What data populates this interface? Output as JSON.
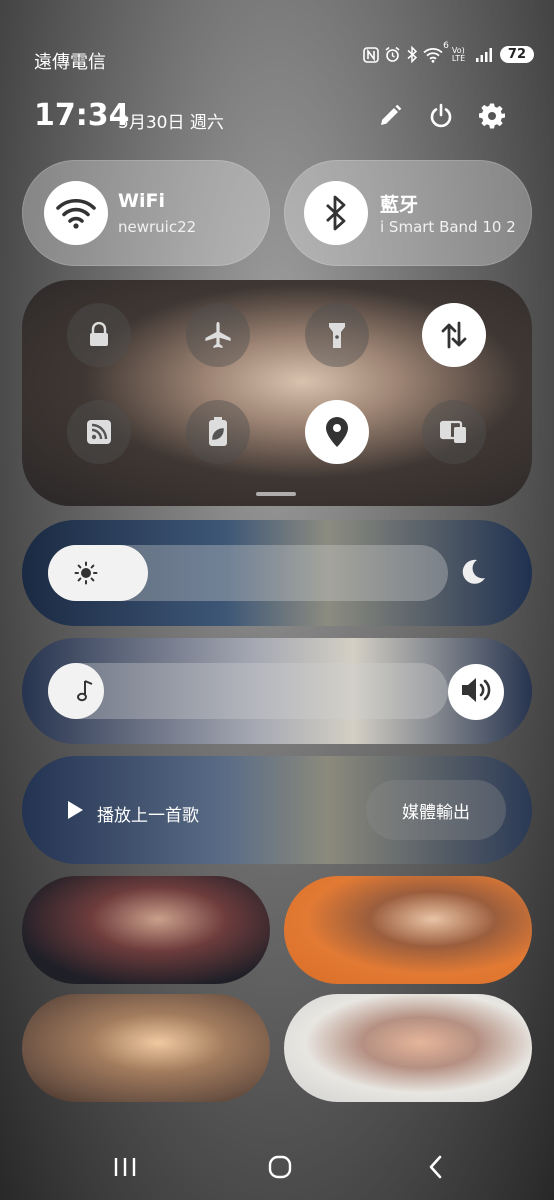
{
  "status_bar": {
    "carrier": "遠傳電信",
    "icons": [
      "nfc-icon",
      "alarm-icon",
      "bluetooth-icon",
      "wifi-icon",
      "volte-icon",
      "signal-icon"
    ],
    "wifi_sup": "6",
    "volte_label": "Vo) LTE",
    "battery": "72"
  },
  "header": {
    "time": "17:34",
    "date": "5月30日 週六",
    "icons": [
      "edit-icon",
      "power-icon",
      "settings-icon"
    ]
  },
  "big_tiles": [
    {
      "title": "WiFi",
      "subtitle": "newruic22",
      "icon": "wifi-icon",
      "active": true
    },
    {
      "title": "藍牙",
      "subtitle": "i Smart Band 10 2",
      "icon": "bluetooth-icon",
      "active": true
    }
  ],
  "quick_settings": [
    {
      "icon": "lock-icon",
      "active": false
    },
    {
      "icon": "airplane-icon",
      "active": false
    },
    {
      "icon": "flashlight-icon",
      "active": false
    },
    {
      "icon": "data-transfer-icon",
      "active": true
    },
    {
      "icon": "rss-icon",
      "active": false
    },
    {
      "icon": "battery-saver-icon",
      "active": false
    },
    {
      "icon": "location-icon",
      "active": true
    },
    {
      "icon": "device-cast-icon",
      "active": false
    }
  ],
  "brightness": {
    "level": 0.25,
    "icon_left": "sun-icon",
    "icon_right": "moon-icon"
  },
  "volume": {
    "level": 0.06,
    "icon_left": "music-note-icon",
    "icon_right": "speaker-icon"
  },
  "media": {
    "play_label": "播放上一首歌",
    "output_label": "媒體輸出"
  },
  "nav": [
    "recents-icon",
    "home-icon",
    "back-icon"
  ],
  "colors": {
    "tile_active": "#ffffff",
    "icon_dark": "#333333"
  }
}
